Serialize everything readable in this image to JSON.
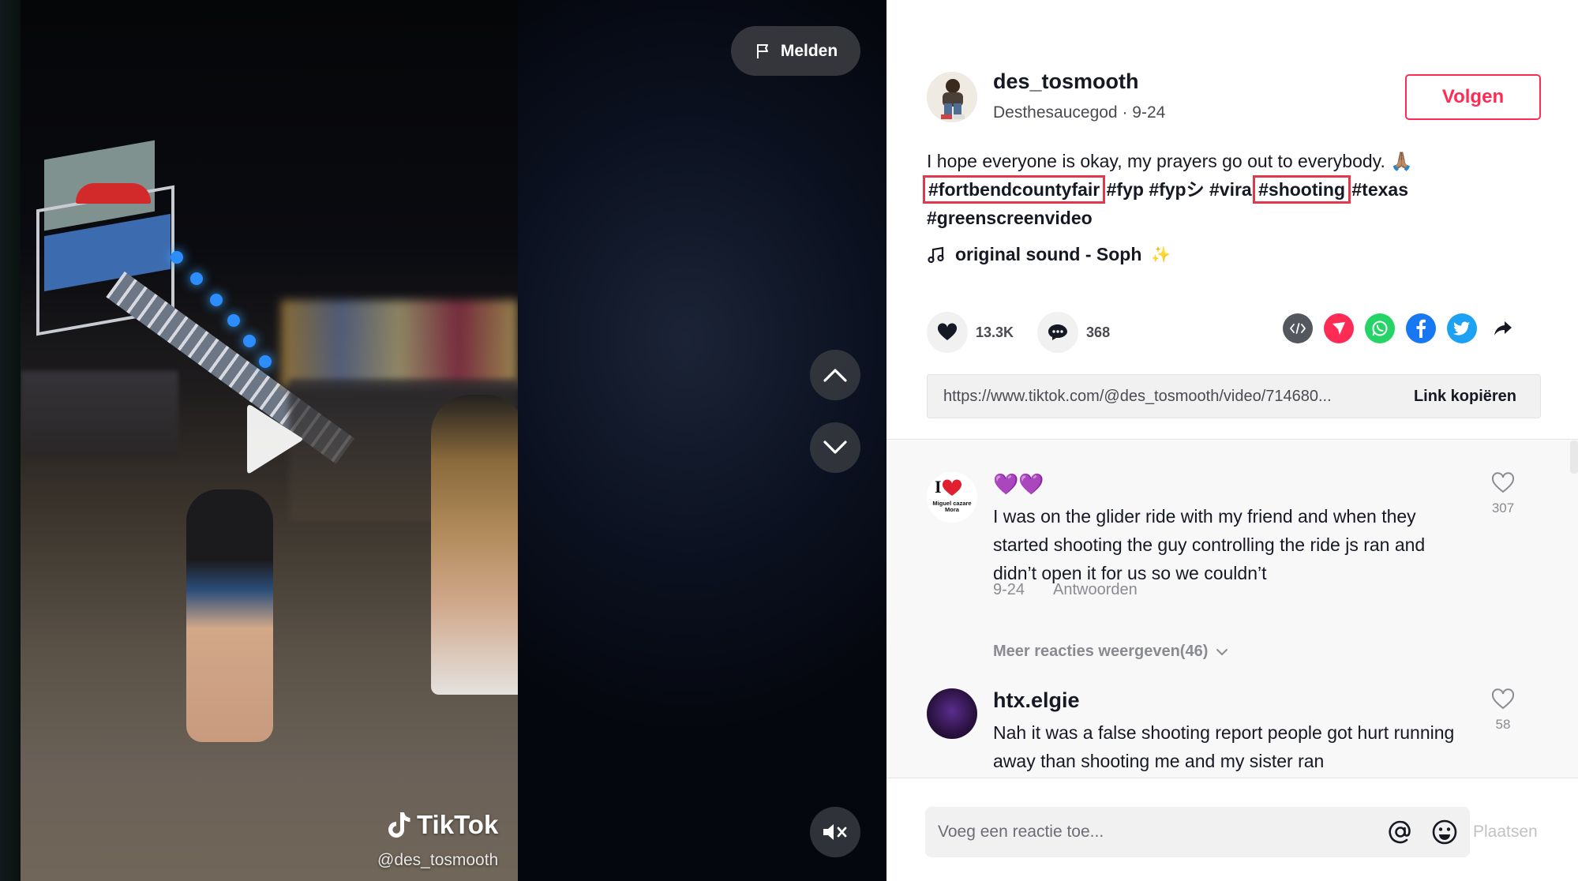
{
  "video": {
    "report_label": "Melden",
    "watermark_brand": "TikTok",
    "watermark_handle": "@des_tosmooth"
  },
  "post": {
    "author": {
      "username": "des_tosmooth",
      "display_name": "Desthesaucegod",
      "date": "9-24"
    },
    "follow_label": "Volgen",
    "caption_text": "I hope everyone is okay, my prayers go out to everybody. 🙏🏽",
    "hashtags": [
      "#fortbendcountyfair",
      "#fyp",
      "#fypシ",
      "#vira",
      "#shooting",
      "#texas",
      "#greenscreenvideo"
    ],
    "highlighted_hashtags": [
      "#fortbendcountyfair",
      "#shooting"
    ],
    "highlight_color": "#e03a4a",
    "music": {
      "title": "original sound - Soph",
      "emoji": "✨"
    },
    "stats": {
      "likes": "13.3K",
      "comments": "368"
    },
    "share_icons": [
      "embed-icon",
      "send-icon",
      "whatsapp-icon",
      "facebook-icon",
      "twitter-icon",
      "share-arrow-icon"
    ],
    "link_url": "https://www.tiktok.com/@des_tosmooth/video/714680...",
    "copy_link_label": "Link kopiëren"
  },
  "comments": [
    {
      "name": "💜💜",
      "text": "I was on the glider ride with my friend and when they started shooting the guy controlling the ride js ran and didn’t open it for us so we couldn’t",
      "date": "9-24",
      "reply_label": "Antwoorden",
      "likes": "307",
      "avatar_text": "I ❤ Miguel cazare Mora"
    },
    {
      "name": "htx.elgie",
      "text": "Nah it was a false shooting report people got hurt running away than shooting me and my sister ran",
      "likes": "58"
    }
  ],
  "more_replies_label": "Meer reacties weergeven(46)",
  "comment_bar": {
    "placeholder": "Voeg een reactie toe...",
    "post_label": "Plaatsen"
  },
  "colors": {
    "accent": "#fe2c55",
    "text_primary": "#161823",
    "text_secondary": "#8a8b91"
  }
}
